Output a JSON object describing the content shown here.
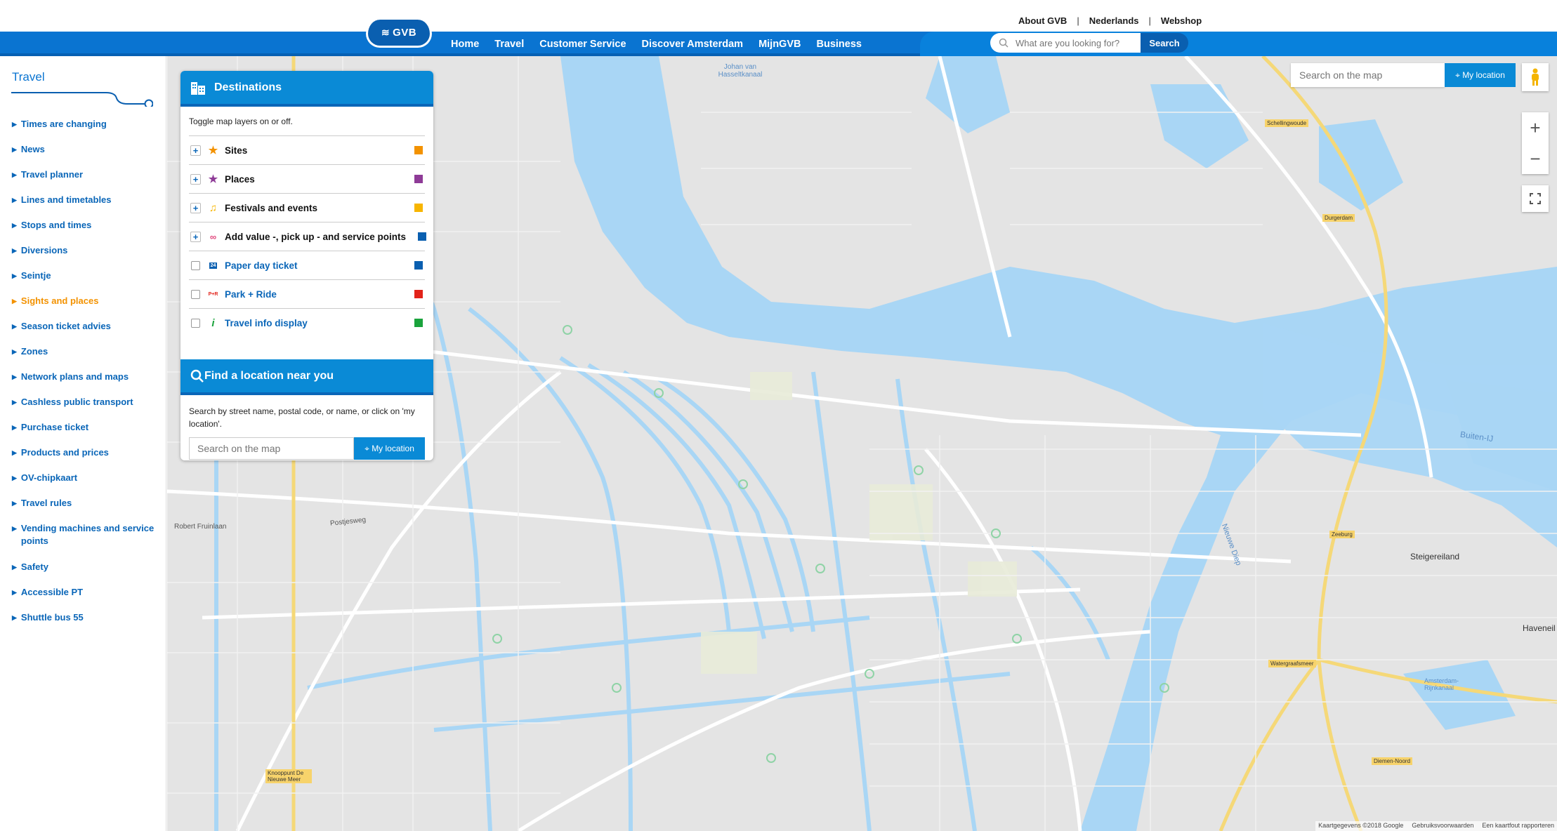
{
  "utility_links": [
    "About GVB",
    "Nederlands",
    "Webshop"
  ],
  "logo": {
    "text": "GVB"
  },
  "nav": [
    {
      "label": "Home",
      "active": false
    },
    {
      "label": "Travel",
      "active": true
    },
    {
      "label": "Customer Service",
      "active": false
    },
    {
      "label": "Discover Amsterdam",
      "active": false
    },
    {
      "label": "MijnGVB",
      "active": false
    },
    {
      "label": "Business",
      "active": false
    }
  ],
  "header_search": {
    "placeholder": "What are you looking for?",
    "button": "Search"
  },
  "sidebar": {
    "title": "Travel",
    "items": [
      "Times are changing",
      "News",
      "Travel planner",
      "Lines and timetables",
      "Stops and times",
      "Diversions",
      "Seintje",
      "Sights and places",
      "Season ticket advies",
      "Zones",
      "Network plans and maps",
      "Cashless public transport",
      "Purchase ticket",
      "Products and prices",
      "OV-chipkaart",
      "Travel rules",
      "Vending machines and service points",
      "Safety",
      "Accessible PT",
      "Shuttle bus 55"
    ],
    "active_item": "Sights and places"
  },
  "panel": {
    "title": "Destinations",
    "toggle_text": "Toggle map layers on or off.",
    "layers": [
      {
        "label": "Sites",
        "icon": "star-icon",
        "color": "#f39200"
      },
      {
        "label": "Places",
        "icon": "star-icon",
        "color": "#8e3b97"
      },
      {
        "label": "Festivals and events",
        "icon": "music-note-icon",
        "color": "#f7b500"
      },
      {
        "label": "Add value -, pick up - and service points",
        "icon": "ov-chip-icon",
        "color": "#0a5fb0"
      },
      {
        "label": "Paper day ticket",
        "icon": "ticket-24-icon",
        "color": "#0a5fb0"
      },
      {
        "label": "Park + Ride",
        "icon": "park-ride-icon",
        "color": "#e2231a"
      },
      {
        "label": "Travel info display",
        "icon": "info-icon",
        "color": "#1aa33c"
      }
    ],
    "find": {
      "title": "Find a location near you",
      "text": "Search by street name, postal code, or name, or click on 'my location'.",
      "placeholder": "Search on the map",
      "button": "My location"
    }
  },
  "map": {
    "search_placeholder": "Search on the map",
    "location_button": "My location",
    "labels": [
      "Johan van Hasseltkanaal",
      "Steigereiland",
      "Buiten-IJ",
      "Robert Fruinlaan",
      "Postjesweg",
      "Nieuwe Diep",
      "Haveneil",
      "Schellingwoude",
      "Durgerdam",
      "Zeeburg",
      "Watergraafsmeer",
      "Diemen-Noord",
      "Knooppunt De Nieuwe Meer",
      "Amsterdam-Rijnkanaal"
    ],
    "attribution": [
      "Kaartgegevens ©2018 Google",
      "Gebruiksvoorwaarden",
      "Een kaartfout rapporteren"
    ]
  },
  "colors": {
    "brand_blue": "#0a74d1",
    "accent_orange": "#f39200",
    "water": "#a9d6f5",
    "land": "#e4e4e4"
  }
}
